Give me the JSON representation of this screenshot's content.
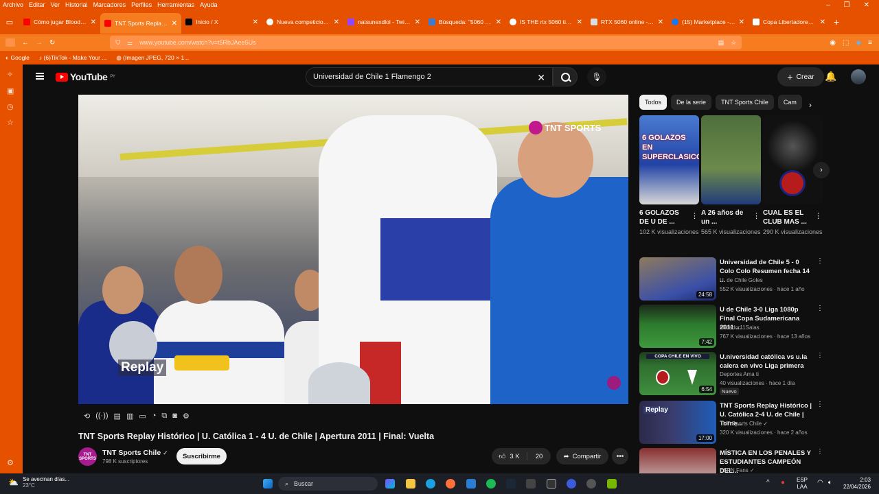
{
  "menubar": {
    "items": [
      "Archivo",
      "Editar",
      "Ver",
      "Historial",
      "Marcadores",
      "Perfiles",
      "Herramientas",
      "Ayuda"
    ]
  },
  "tabs": [
    {
      "title": "Cómo jugar Bloodborne",
      "icon_color": "#ff0000"
    },
    {
      "title": "TNT Sports Replay Histó",
      "icon_color": "#ff0000"
    },
    {
      "title": "Inicio / X",
      "icon_color": "#000000"
    },
    {
      "title": "Nueva competicion con",
      "icon_color": "#4285f4"
    },
    {
      "title": "natsunexdlol - Twitch",
      "icon_color": "#9146ff"
    },
    {
      "title": "Búsqueda: \"5060 ti 16",
      "icon_color": "#3a7bd5"
    },
    {
      "title": "IS THE rtx 5060 ti 16 gb",
      "icon_color": "#4285f4"
    },
    {
      "title": "RTX 5060 online - Here",
      "icon_color": "#ffffff"
    },
    {
      "title": "(15) Marketplace - Tarje",
      "icon_color": "#1877f2"
    },
    {
      "title": "Copa Libertadores 2011",
      "icon_color": "#ffffff"
    }
  ],
  "url": "www.youtube.com/watch?v=t5RbJAee5Us",
  "bookmarks": [
    "Google",
    "(6)TikTok - Make Your ...",
    "(Imagen JPEG, 720 × 1..."
  ],
  "youtube": {
    "logo_text": "YouTube",
    "logo_region": "PY",
    "search_value": "Universidad de Chile 1 Flamengo 2",
    "create_label": "Crear"
  },
  "video": {
    "title": "TNT Sports Replay Histórico | U. Católica 1 - 4 U. de Chile | Apertura 2011 | Final: Vuelta",
    "overlay_brand": "TNT SPORTS",
    "overlay_replay": "Replay",
    "channel_avatar_text": "TNT SPORTS",
    "channel_name": "TNT Sports Chile",
    "channel_subs": "798 K suscriptores",
    "subscribe_label": "Suscribirme",
    "likes": "3 K",
    "dislikes": "20",
    "share_label": "Compartir"
  },
  "chips": [
    "Todos",
    "De la serie",
    "TNT Sports Chile",
    "Cam"
  ],
  "shorts": [
    {
      "title": "6 GOLAZOS DE U DE ...",
      "views": "102 K visualizaciones",
      "overlay": "6 GOLAZOS EN SUPERCLASICO"
    },
    {
      "title": "A 26 años de un ...",
      "views": "565 K visualizaciones"
    },
    {
      "title": "CUAL ES EL CLUB MAS ...",
      "views": "290 K visualizaciones"
    }
  ],
  "recommendations": [
    {
      "title": "Universidad de Chile 5 - 0 Colo Colo Resumen fecha 14 ...",
      "channel": "U. de Chile Goles",
      "meta": "552 K visualizaciones · hace 1 año",
      "duration": "24:58"
    },
    {
      "title": "U de Chile 3-0 Liga 1080p Final Copa Sudamericana 2011 ...",
      "channel": "Matador11Salas",
      "meta": "767 K visualizaciones · hace 13 años",
      "duration": "7:42"
    },
    {
      "title": "U.niversidad católica vs u.la calera en vivo Liga primera",
      "channel": "Deportes Ama ti",
      "meta": "40 visualizaciones · hace 1 día",
      "duration": "6:54",
      "badge": "Nuevo",
      "overlay": "COPA CHILE EN VIVO"
    },
    {
      "title": "TNT Sports Replay Histórico | U. Católica 2-4 U. de Chile | Torne...",
      "channel": "TNT Sports Chile ✓",
      "meta": "320 K visualizaciones · hace 2 años",
      "duration": "17:00",
      "overlay": "Replay"
    },
    {
      "title": "MÍSTICA EN LOS PENALES Y ESTUDIANTES CAMPEÓN DEL...",
      "channel": "ESPN Fans ✓",
      "meta": "",
      "duration": ""
    }
  ],
  "taskbar": {
    "weather_text": "Se avecinan días...",
    "temp": "23°C",
    "search_label": "Buscar",
    "lang": "ESP",
    "lang2": "LAA",
    "time": "2:03",
    "date": "22/04/2026"
  }
}
